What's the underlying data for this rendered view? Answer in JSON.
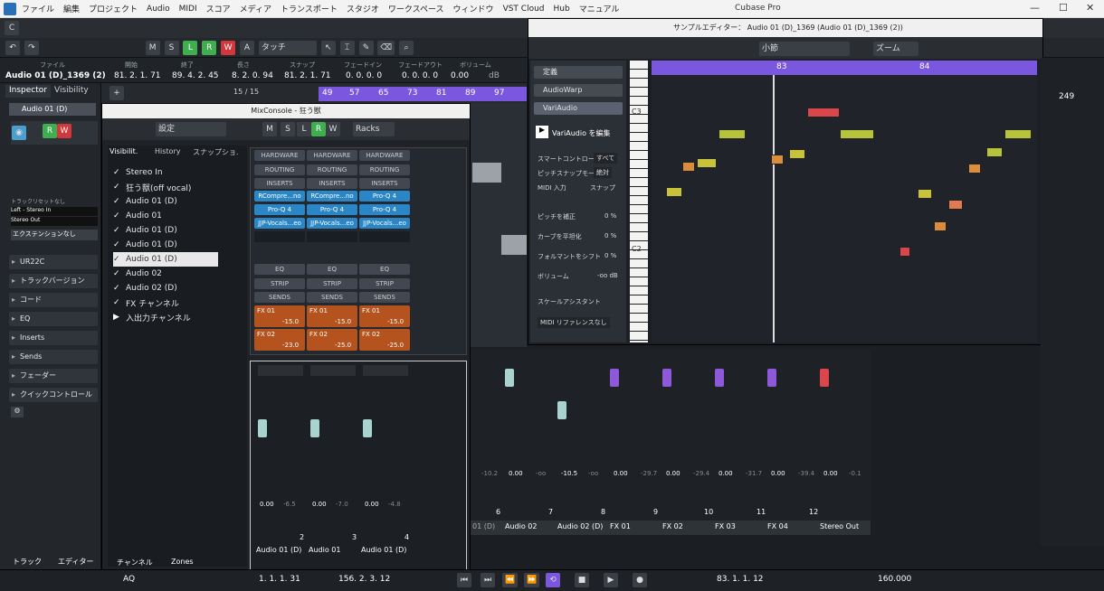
{
  "menubar": {
    "items": [
      "ファイル",
      "編集",
      "プロジェクト",
      "Audio",
      "MIDI",
      "スコア",
      "メディア",
      "トランスポート",
      "スタジオ",
      "ワークスペース",
      "ウィンドウ",
      "VST Cloud",
      "Hub",
      "マニュアル"
    ],
    "app_title": "Cubase Pro"
  },
  "toolbar": {
    "m": "M",
    "s": "S",
    "l": "L",
    "r": "R",
    "w": "W",
    "a": "A",
    "touch": "タッチ"
  },
  "info": {
    "file_label": "ファイル",
    "file_value": "Audio 01 (D)_1369 (2)",
    "start_label": "開始",
    "start": "81. 2. 1. 71",
    "end_label": "終了",
    "end": "89. 4. 2. 45",
    "len_label": "長さ",
    "len": "8. 2. 0. 94",
    "snap_label": "スナップ",
    "snap": "81. 2. 1. 71",
    "fi_label": "フェードイン",
    "fi": "0. 0. 0. 0",
    "fo_label": "フェードアウト",
    "fo": "0. 0. 0. 0",
    "vol_label": "ボリューム",
    "vol": "0.00",
    "vol_unit": "dB"
  },
  "inspector": {
    "tab1": "Inspector",
    "tab2": "Visibility",
    "track": "Audio 01 (D)",
    "bypass": "トラックリセットなし",
    "in": "Left - Stereo In",
    "out": "Stereo Out",
    "ext": "エクステンションなし",
    "sections": [
      "UR22C",
      "トラックバージョン",
      "コード",
      "EQ",
      "Inserts",
      "Sends",
      "フェーダー",
      "クイックコントロール"
    ],
    "bottom_tab1": "トラック",
    "bottom_tab2": "エディター"
  },
  "arr": {
    "count": "15 / 15",
    "bars": [
      "49",
      "57",
      "65",
      "73",
      "81",
      "89",
      "97"
    ]
  },
  "mix": {
    "title": "MixConsole - 狂う獣",
    "settings": "設定",
    "racks": "Racks",
    "tab_vis": "Visibilit.",
    "tab_hist": "History",
    "tab_snap": "スナップショ.",
    "rows": [
      "Stereo In",
      "狂う獣(off vocal)",
      "Audio 01 (D)",
      "Audio 01",
      "Audio 01 (D)",
      "Audio 01 (D)",
      "Audio 01 (D)",
      "Audio 02",
      "Audio 02 (D)",
      "FX チャンネル",
      "入出力チャンネル"
    ],
    "hardware": "HARDWARE",
    "routing": "ROUTING",
    "inserts": "INSERTS",
    "eq": "EQ",
    "strip": "STRIP",
    "sends": "SENDS",
    "ins_rows": [
      [
        "RCompre...no",
        "RCompre...no",
        "Pro-Q 4"
      ],
      [
        "Pro-Q 4",
        "Pro-Q 4",
        "Pro-Q 4"
      ],
      [
        "JJP-Vocals...eo",
        "JJP-Vocals...eo",
        "JJP-Vocals...eo"
      ]
    ],
    "sends1": [
      "FX 01",
      "FX 01",
      "FX 01"
    ],
    "sends1v": [
      "-15.0",
      "-15.0",
      "-15.0"
    ],
    "sends2": [
      "FX 02",
      "FX 02",
      "FX 02"
    ],
    "sends2v": [
      "-23.0",
      "-25.0",
      "-25.0"
    ],
    "ch_names": [
      "Audio 01 (D)",
      "Audio 01",
      "Audio 01 (D)"
    ],
    "ch_nums": [
      "2",
      "3",
      "4"
    ],
    "fader_vals": [
      "0.00",
      "0.00",
      "0.00"
    ],
    "peak_vals": [
      "-6.5",
      "-7.0",
      "-4.8"
    ],
    "tab_channel": "チャンネル",
    "tab_zones": "Zones"
  },
  "sample": {
    "title": "サンプルエディター： Audio 01 (D)_1369 (Audio 01 (D)_1369 (2))",
    "bar": "小節",
    "zoom": "ズーム",
    "def": "定義",
    "warp": "AudioWarp",
    "vari": "VariAudio",
    "edit": "VariAudio を編集",
    "smart": "スマートコントロール",
    "smart_v": "すべて",
    "snapmode": "ピッチスナップモード",
    "snapmode_v": "絶対",
    "midi": "MIDI 入力",
    "snap": "スナップ",
    "pc": "ピッチを補正",
    "pc_v": "0 %",
    "cs": "カーブを平坦化",
    "cs_v": "0 %",
    "fs": "フォルマントをシフト",
    "fs_v": "0 %",
    "vol": "ボリューム",
    "vol_v": "-oo dB",
    "scale": "スケールアシスタント",
    "midiref": "MIDI リファレンスなし",
    "ruler": [
      "83",
      "84"
    ],
    "keys": [
      "C3",
      "C2"
    ]
  },
  "mainmix": {
    "names": [
      "01 (D)",
      "Audio 02",
      "Audio 02 (D)",
      "FX 01",
      "FX 02",
      "FX 03",
      "FX 04",
      "Stereo Out"
    ],
    "nums": [
      "6",
      "7",
      "8",
      "9",
      "10",
      "11",
      "12"
    ],
    "vals": [
      "0.00",
      "0.00",
      "-10.5",
      "0.00",
      "0.00",
      "0.00",
      "0.00",
      "0.00"
    ],
    "peaks": [
      "-10.2",
      "-oo",
      "-oo",
      "-29.7",
      "-29.4",
      "-31.7",
      "-39.4",
      "-0.1"
    ]
  },
  "right": {
    "num": "249"
  },
  "transport": {
    "pos1": "1. 1. 1. 31",
    "pos2": "156. 2. 3. 12",
    "pos3": "83. 1. 1. 12",
    "tempo": "160.000",
    "aq": "AQ"
  }
}
